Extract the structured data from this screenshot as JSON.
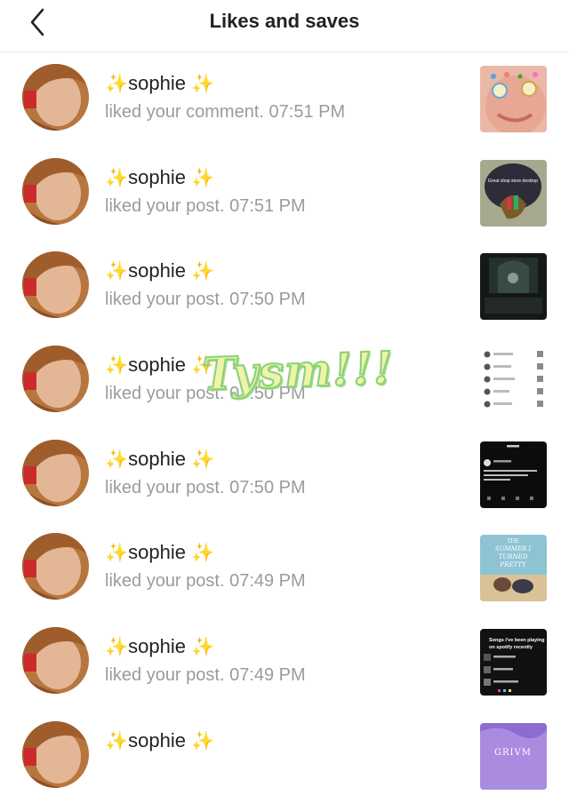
{
  "header": {
    "title": "Likes and saves",
    "back_icon": "chevron-left-icon"
  },
  "sticker_text": "Tysm!!!",
  "notifications": [
    {
      "sparkle_left": "✨",
      "name": "sophie",
      "sparkle_right": "✨",
      "action": "liked your comment.",
      "time": "07:51 PM"
    },
    {
      "sparkle_left": "✨",
      "name": "sophie",
      "sparkle_right": "✨",
      "action": "liked your post.",
      "time": "07:51 PM"
    },
    {
      "sparkle_left": "✨",
      "name": "sophie",
      "sparkle_right": "✨",
      "action": "liked your post.",
      "time": "07:50 PM"
    },
    {
      "sparkle_left": "✨",
      "name": "sophie",
      "sparkle_right": "✨",
      "action": "liked your post.",
      "time": "07:50 PM"
    },
    {
      "sparkle_left": "✨",
      "name": "sophie",
      "sparkle_right": "✨",
      "action": "liked your post.",
      "time": "07:50 PM"
    },
    {
      "sparkle_left": "✨",
      "name": "sophie",
      "sparkle_right": "✨",
      "action": "liked your post.",
      "time": "07:49 PM"
    },
    {
      "sparkle_left": "✨",
      "name": "sophie",
      "sparkle_right": "✨",
      "action": "liked your post.",
      "time": "07:49 PM"
    },
    {
      "sparkle_left": "✨",
      "name": "sophie",
      "sparkle_right": "✨",
      "action": "",
      "time": ""
    }
  ],
  "thumb_text": {
    "t2": "Great shop store desktop",
    "t6_line1": "THE",
    "t6_line2": "SUMMER I",
    "t6_line3": "TURNED",
    "t6_line4": "PRETTY",
    "t7_line1": "Songs i've been playing",
    "t7_line2": "on spotify recently",
    "t8": "GRIVM"
  },
  "colors": {
    "sparkle": "#f2c600",
    "sub_text": "#9b9b9b",
    "sticker_fill": "#f0f4a8",
    "sticker_stroke": "#8ad17a"
  }
}
